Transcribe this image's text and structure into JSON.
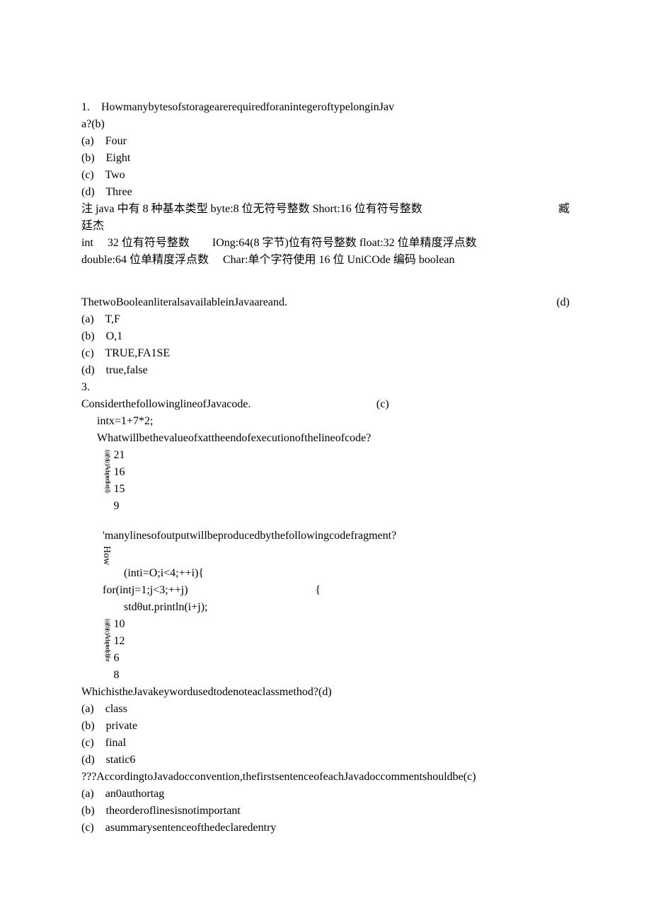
{
  "q1": {
    "line1": "1.    HowmanybytesofstoragearerequiredforanintegeroftypelonginJav",
    "line2": "a?(b)",
    "a": "(a)    Four",
    "b": "(b)    Eight",
    "c": "(c)    Two",
    "d": "(d)    Three",
    "note1": "注 java 中有 8 种基本类型 byte:8 位无符号整数 Short:16 位有符号整数",
    "note1_right": "臧",
    "note2": "廷杰",
    "note3": "int     32 位有符号整数        IOng:64(8 字节)位有符号整数 float:32 位单精度浮点数",
    "note4": "double:64 位单精度浮点数     Char:单个字符使用 16 位 UniCOde 编码 boolean"
  },
  "q2": {
    "stem": "ThetwoBooleanliteralsavailableinJavaareand.",
    "answer": "(d)",
    "a": "(a)    T,F",
    "b": "(b)    O,1",
    "c": "(c)    TRUE,FA1SE",
    "d": "(d)    true,false"
  },
  "q3": {
    "num": "3.",
    "stem": "ConsiderthefollowinglineofJavacode.",
    "answer": "(c)",
    "code": "intx=1+7*2;",
    "sub": "Whatwillbethevalueofxattheendofexecutionofthelineofcode?",
    "vlabel": "(a)(b)(c)Adaptedfor(d)",
    "v1": "21",
    "v2": "16",
    "v3": "15",
    "v4": "9"
  },
  "q4": {
    "stem": "'manylinesofoutputwillbeproducedbythefollowingcodefragment?",
    "vlabel1": "How",
    "code1": "(inti=O;i<4;++i){",
    "code2": "for(intj=1;j<3;++j)",
    "brace": "{",
    "code3": "stdθut.println(i+j);",
    "vlabel2": "(a)(b)(c)Adapted(d)for",
    "v1": "10",
    "v2": "12",
    "v3": "6",
    "v4": "8"
  },
  "q5": {
    "stem": "WhichistheJavakeywordusedtodenoteaclassmethod?(d)",
    "a": "(a)    class",
    "b": "(b)    private",
    "c": "(c)    final",
    "d": "(d)    static6"
  },
  "q6": {
    "stem": "???AccordingtoJavadocconvention,thefirstsentenceofeachJavadoccommentshouldbe(c)",
    "a": "(a)    an0authortag",
    "b": "(b)    theorderoflinesisnotimportant",
    "c": "(c)    asummarysentenceofthedeclaredentry"
  }
}
